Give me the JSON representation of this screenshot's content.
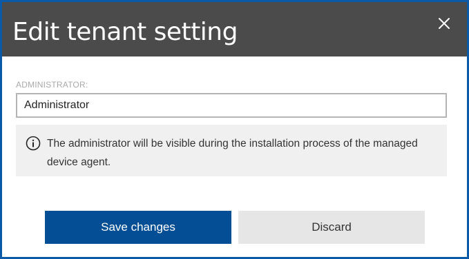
{
  "dialog": {
    "title": "Edit tenant setting",
    "close_icon": "close-icon"
  },
  "field": {
    "label": "ADMINISTRATOR:",
    "value": "Administrator"
  },
  "info": {
    "icon": "info-icon",
    "text": "The administrator will be visible during the installation process of the managed device agent."
  },
  "buttons": {
    "save": "Save changes",
    "discard": "Discard"
  },
  "colors": {
    "header_bg": "#4b4b4b",
    "primary": "#034e94",
    "border": "#0a5aa8"
  }
}
